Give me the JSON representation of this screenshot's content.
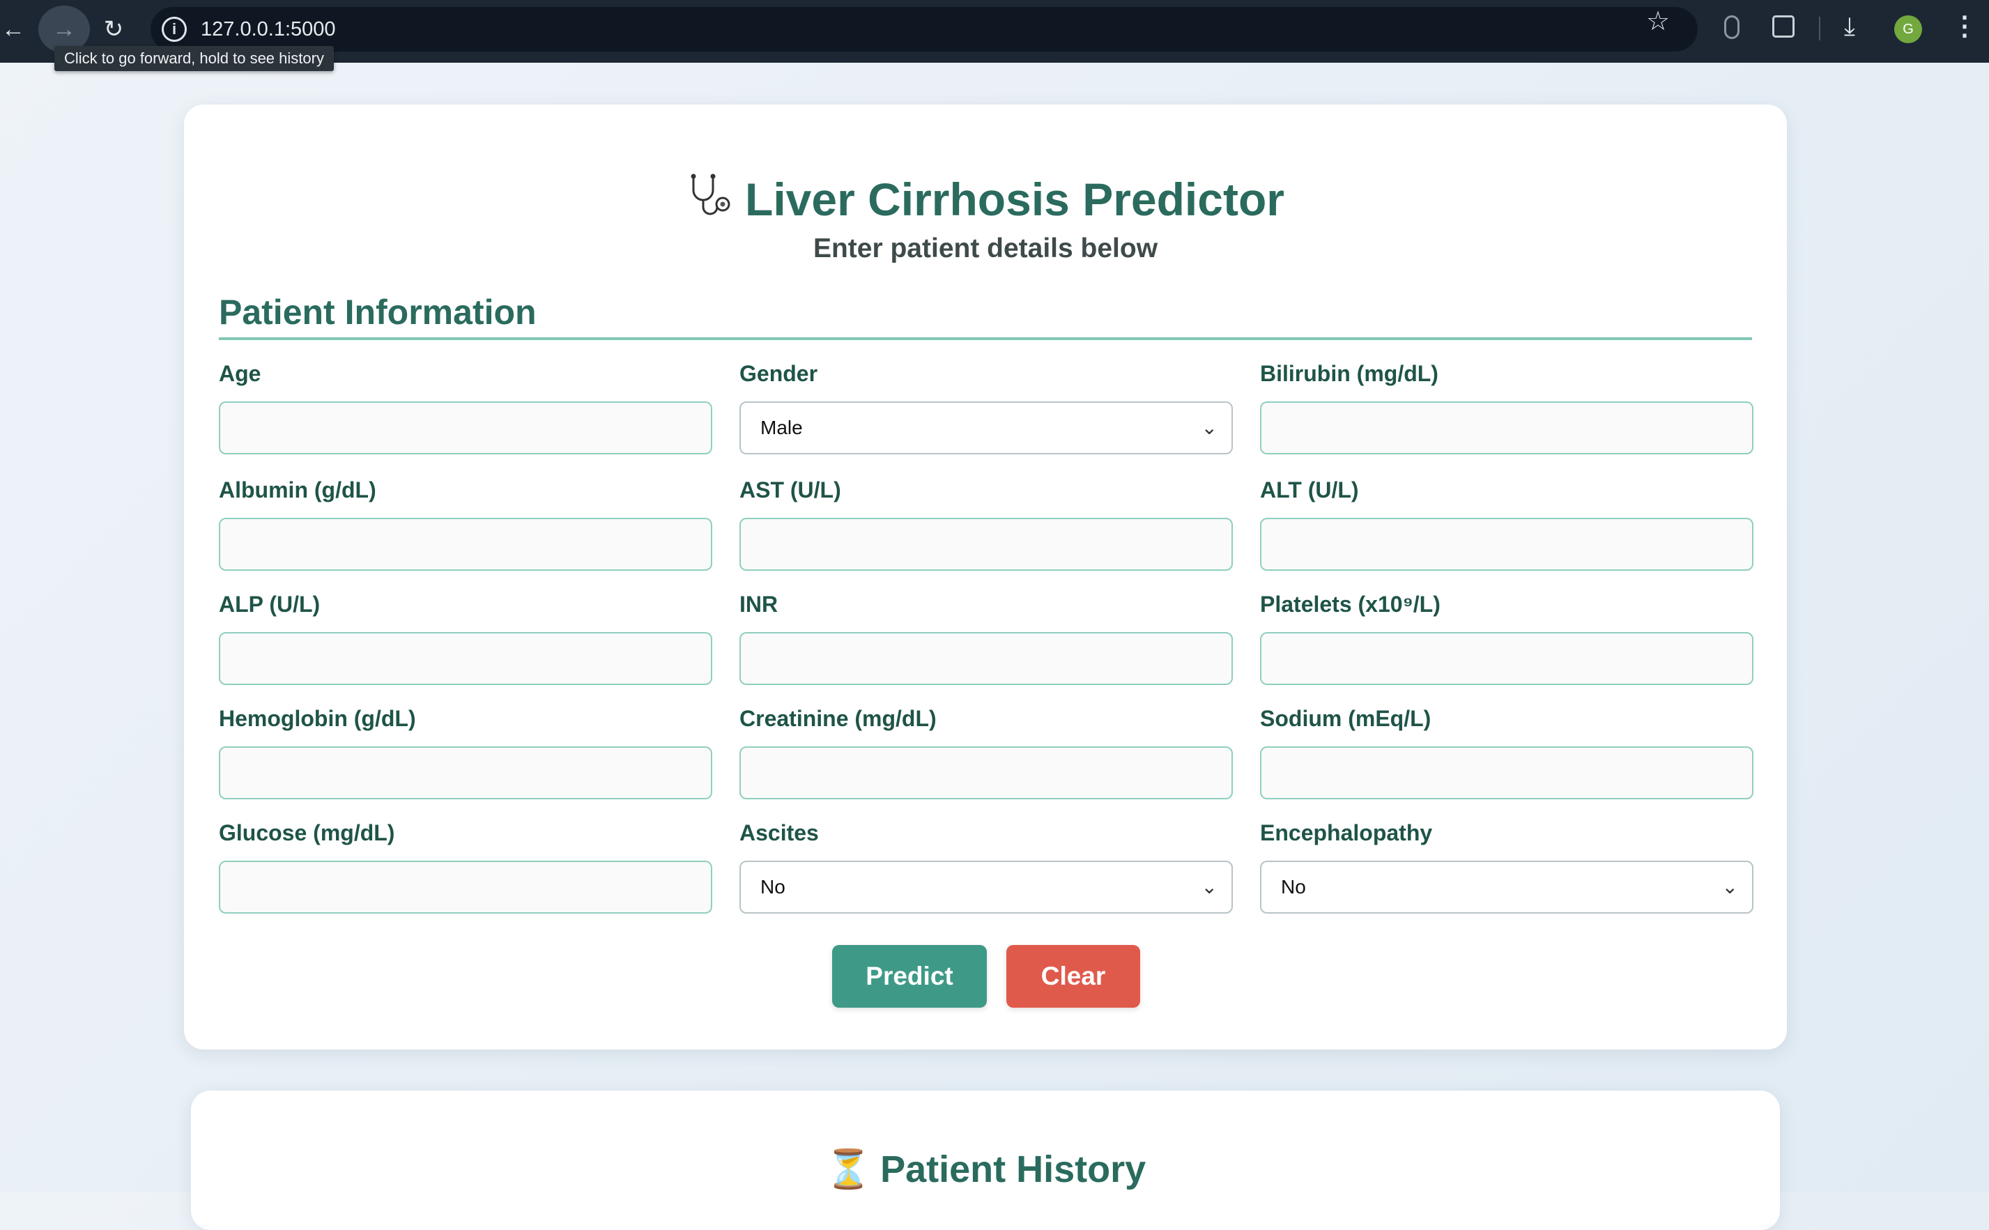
{
  "browser": {
    "url": "127.0.0.1:5000",
    "tooltip": "Click to go forward, hold to see history",
    "profile_initial": "G",
    "icons": {
      "back": "back-arrow-icon",
      "forward": "forward-arrow-icon",
      "reload": "reload-icon",
      "site_info": "info-icon",
      "bookmark": "star-icon",
      "extension": "extension-icon",
      "downloads": "download-icon",
      "menu": "kebab-menu-icon"
    }
  },
  "header": {
    "title_icon": "stethoscope-icon",
    "title": "Liver Cirrhosis Predictor",
    "subtitle": "Enter patient details below"
  },
  "section": {
    "title": "Patient Information"
  },
  "fields": {
    "age": {
      "label": "Age",
      "value": ""
    },
    "gender": {
      "label": "Gender",
      "value": "Male"
    },
    "bilirubin": {
      "label": "Bilirubin (mg/dL)",
      "value": ""
    },
    "albumin": {
      "label": "Albumin (g/dL)",
      "value": ""
    },
    "ast": {
      "label": "AST (U/L)",
      "value": ""
    },
    "alt": {
      "label": "ALT (U/L)",
      "value": ""
    },
    "alp": {
      "label": "ALP (U/L)",
      "value": ""
    },
    "inr": {
      "label": "INR",
      "value": ""
    },
    "platelets": {
      "label": "Platelets (x10⁹/L)",
      "value": ""
    },
    "hemoglobin": {
      "label": "Hemoglobin (g/dL)",
      "value": ""
    },
    "creatinine": {
      "label": "Creatinine (mg/dL)",
      "value": ""
    },
    "sodium": {
      "label": "Sodium (mEq/L)",
      "value": ""
    },
    "glucose": {
      "label": "Glucose (mg/dL)",
      "value": ""
    },
    "ascites": {
      "label": "Ascites",
      "value": "No"
    },
    "encephalopathy": {
      "label": "Encephalopathy",
      "value": "No"
    }
  },
  "actions": {
    "predict_label": "Predict",
    "clear_label": "Clear"
  },
  "history": {
    "icon": "hourglass-icon",
    "title": "Patient History"
  },
  "colors": {
    "accent": "#2a6b5e",
    "predict": "#3e9a87",
    "clear": "#e05a4c",
    "chrome_bg": "#1d2733"
  }
}
